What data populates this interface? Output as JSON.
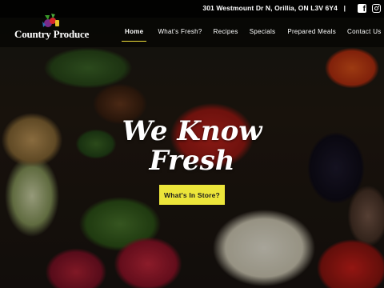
{
  "topbar": {
    "address": "301 Westmount Dr N, Orillia, ON L3V 6Y4",
    "separator": "|",
    "social": [
      "facebook-icon",
      "instagram-icon"
    ]
  },
  "brand": {
    "name": "Country Produce"
  },
  "nav": {
    "items": [
      {
        "label": "Home",
        "active": true
      },
      {
        "label": "What's Fresh?",
        "active": false
      },
      {
        "label": "Recipes",
        "active": false
      },
      {
        "label": "Specials",
        "active": false
      },
      {
        "label": "Prepared Meals",
        "active": false
      },
      {
        "label": "Contact Us",
        "active": false
      }
    ]
  },
  "hero": {
    "headline_line1": "We Know",
    "headline_line2": "Fresh",
    "cta_label": "What's In Store?"
  },
  "colors": {
    "accent": "#ece53a",
    "text": "#ffffff"
  }
}
